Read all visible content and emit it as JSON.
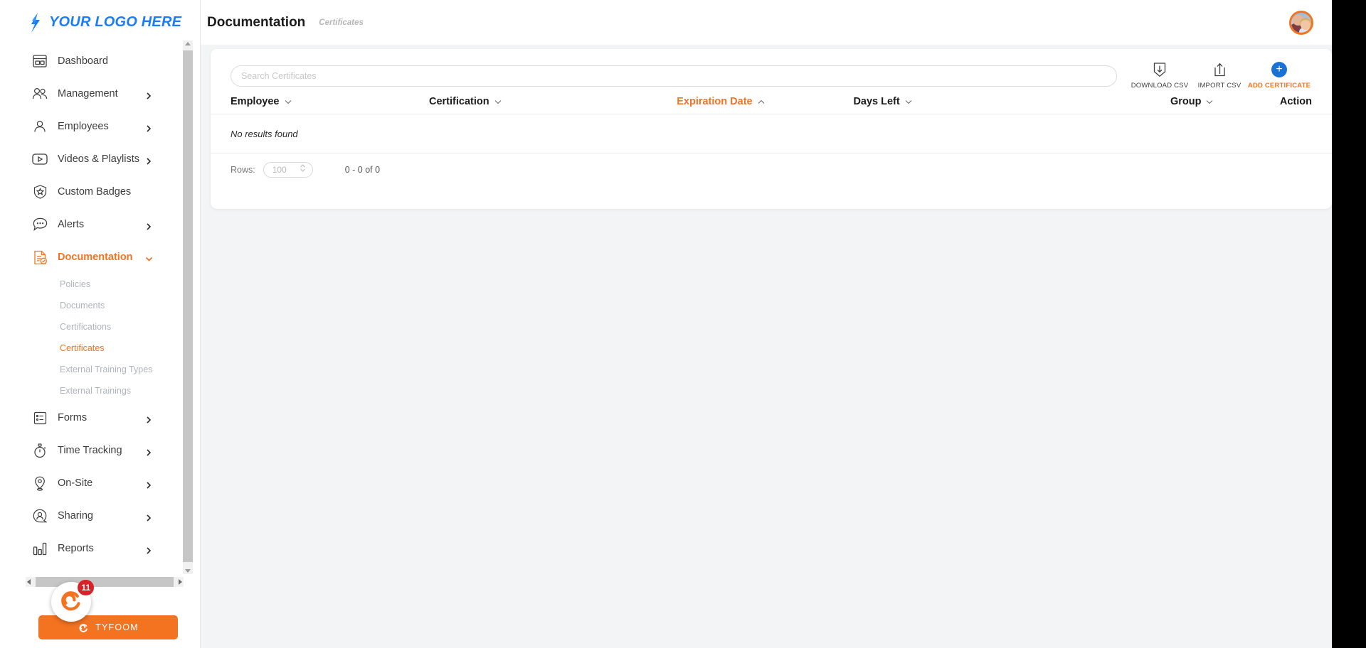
{
  "brand": {
    "logo_text": "YOUR LOGO HERE",
    "logo_color": "#1b7df5",
    "accent_color": "#f47321",
    "blue_accent": "#1a73d4"
  },
  "header": {
    "title": "Documentation",
    "subtitle": "Certificates",
    "avatar_name": "user-avatar"
  },
  "sidebar": {
    "items": [
      {
        "label": "Dashboard",
        "icon": "dashboard-icon",
        "expandable": false,
        "active": false
      },
      {
        "label": "Management",
        "icon": "users-icon",
        "expandable": true,
        "active": false
      },
      {
        "label": "Employees",
        "icon": "user-icon",
        "expandable": true,
        "active": false
      },
      {
        "label": "Videos & Playlists",
        "icon": "video-icon",
        "expandable": true,
        "active": false
      },
      {
        "label": "Custom Badges",
        "icon": "badge-icon",
        "expandable": false,
        "active": false
      },
      {
        "label": "Alerts",
        "icon": "alert-chat-icon",
        "expandable": true,
        "active": false
      },
      {
        "label": "Documentation",
        "icon": "document-check-icon",
        "expandable": true,
        "active": true
      }
    ],
    "documentation_children": [
      {
        "label": "Policies",
        "active": false
      },
      {
        "label": "Documents",
        "active": false
      },
      {
        "label": "Certifications",
        "active": false
      },
      {
        "label": "Certificates",
        "active": true
      },
      {
        "label": "External Training Types",
        "active": false
      },
      {
        "label": "External Trainings",
        "active": false
      }
    ],
    "items_after": [
      {
        "label": "Forms",
        "icon": "form-icon",
        "expandable": true,
        "active": false
      },
      {
        "label": "Time Tracking",
        "icon": "stopwatch-icon",
        "expandable": true,
        "active": false
      },
      {
        "label": "On-Site",
        "icon": "pin-icon",
        "expandable": true,
        "active": false
      },
      {
        "label": "Sharing",
        "icon": "share-user-icon",
        "expandable": true,
        "active": false
      },
      {
        "label": "Reports",
        "icon": "bar-chart-icon",
        "expandable": true,
        "active": false
      }
    ],
    "widget": {
      "label": "TYFOOM",
      "badge_count": "11",
      "badge_color": "#d8222a"
    }
  },
  "search": {
    "placeholder": "Search Certificates",
    "value": ""
  },
  "toolbar": {
    "actions": [
      {
        "label": "DOWNLOAD CSV",
        "icon": "download-icon"
      },
      {
        "label": "IMPORT CSV",
        "icon": "upload-icon"
      },
      {
        "label": "ADD CERTIFICATE",
        "icon": "plus-circle-icon"
      }
    ]
  },
  "table": {
    "columns": [
      {
        "label": "Employee",
        "sortable": true,
        "sorted": false,
        "direction": "down"
      },
      {
        "label": "Certification",
        "sortable": true,
        "sorted": false,
        "direction": "down"
      },
      {
        "label": "Expiration Date",
        "sortable": true,
        "sorted": true,
        "direction": "up"
      },
      {
        "label": "Days Left",
        "sortable": true,
        "sorted": false,
        "direction": "down"
      },
      {
        "label": "Group",
        "sortable": true,
        "sorted": false,
        "direction": "down"
      },
      {
        "label": "Action",
        "sortable": false,
        "sorted": false,
        "direction": "none"
      }
    ],
    "rows": [],
    "empty_message": "No results found"
  },
  "pagination": {
    "rows_label": "Rows:",
    "rows_value": "100",
    "count_text": "0 - 0 of 0"
  }
}
